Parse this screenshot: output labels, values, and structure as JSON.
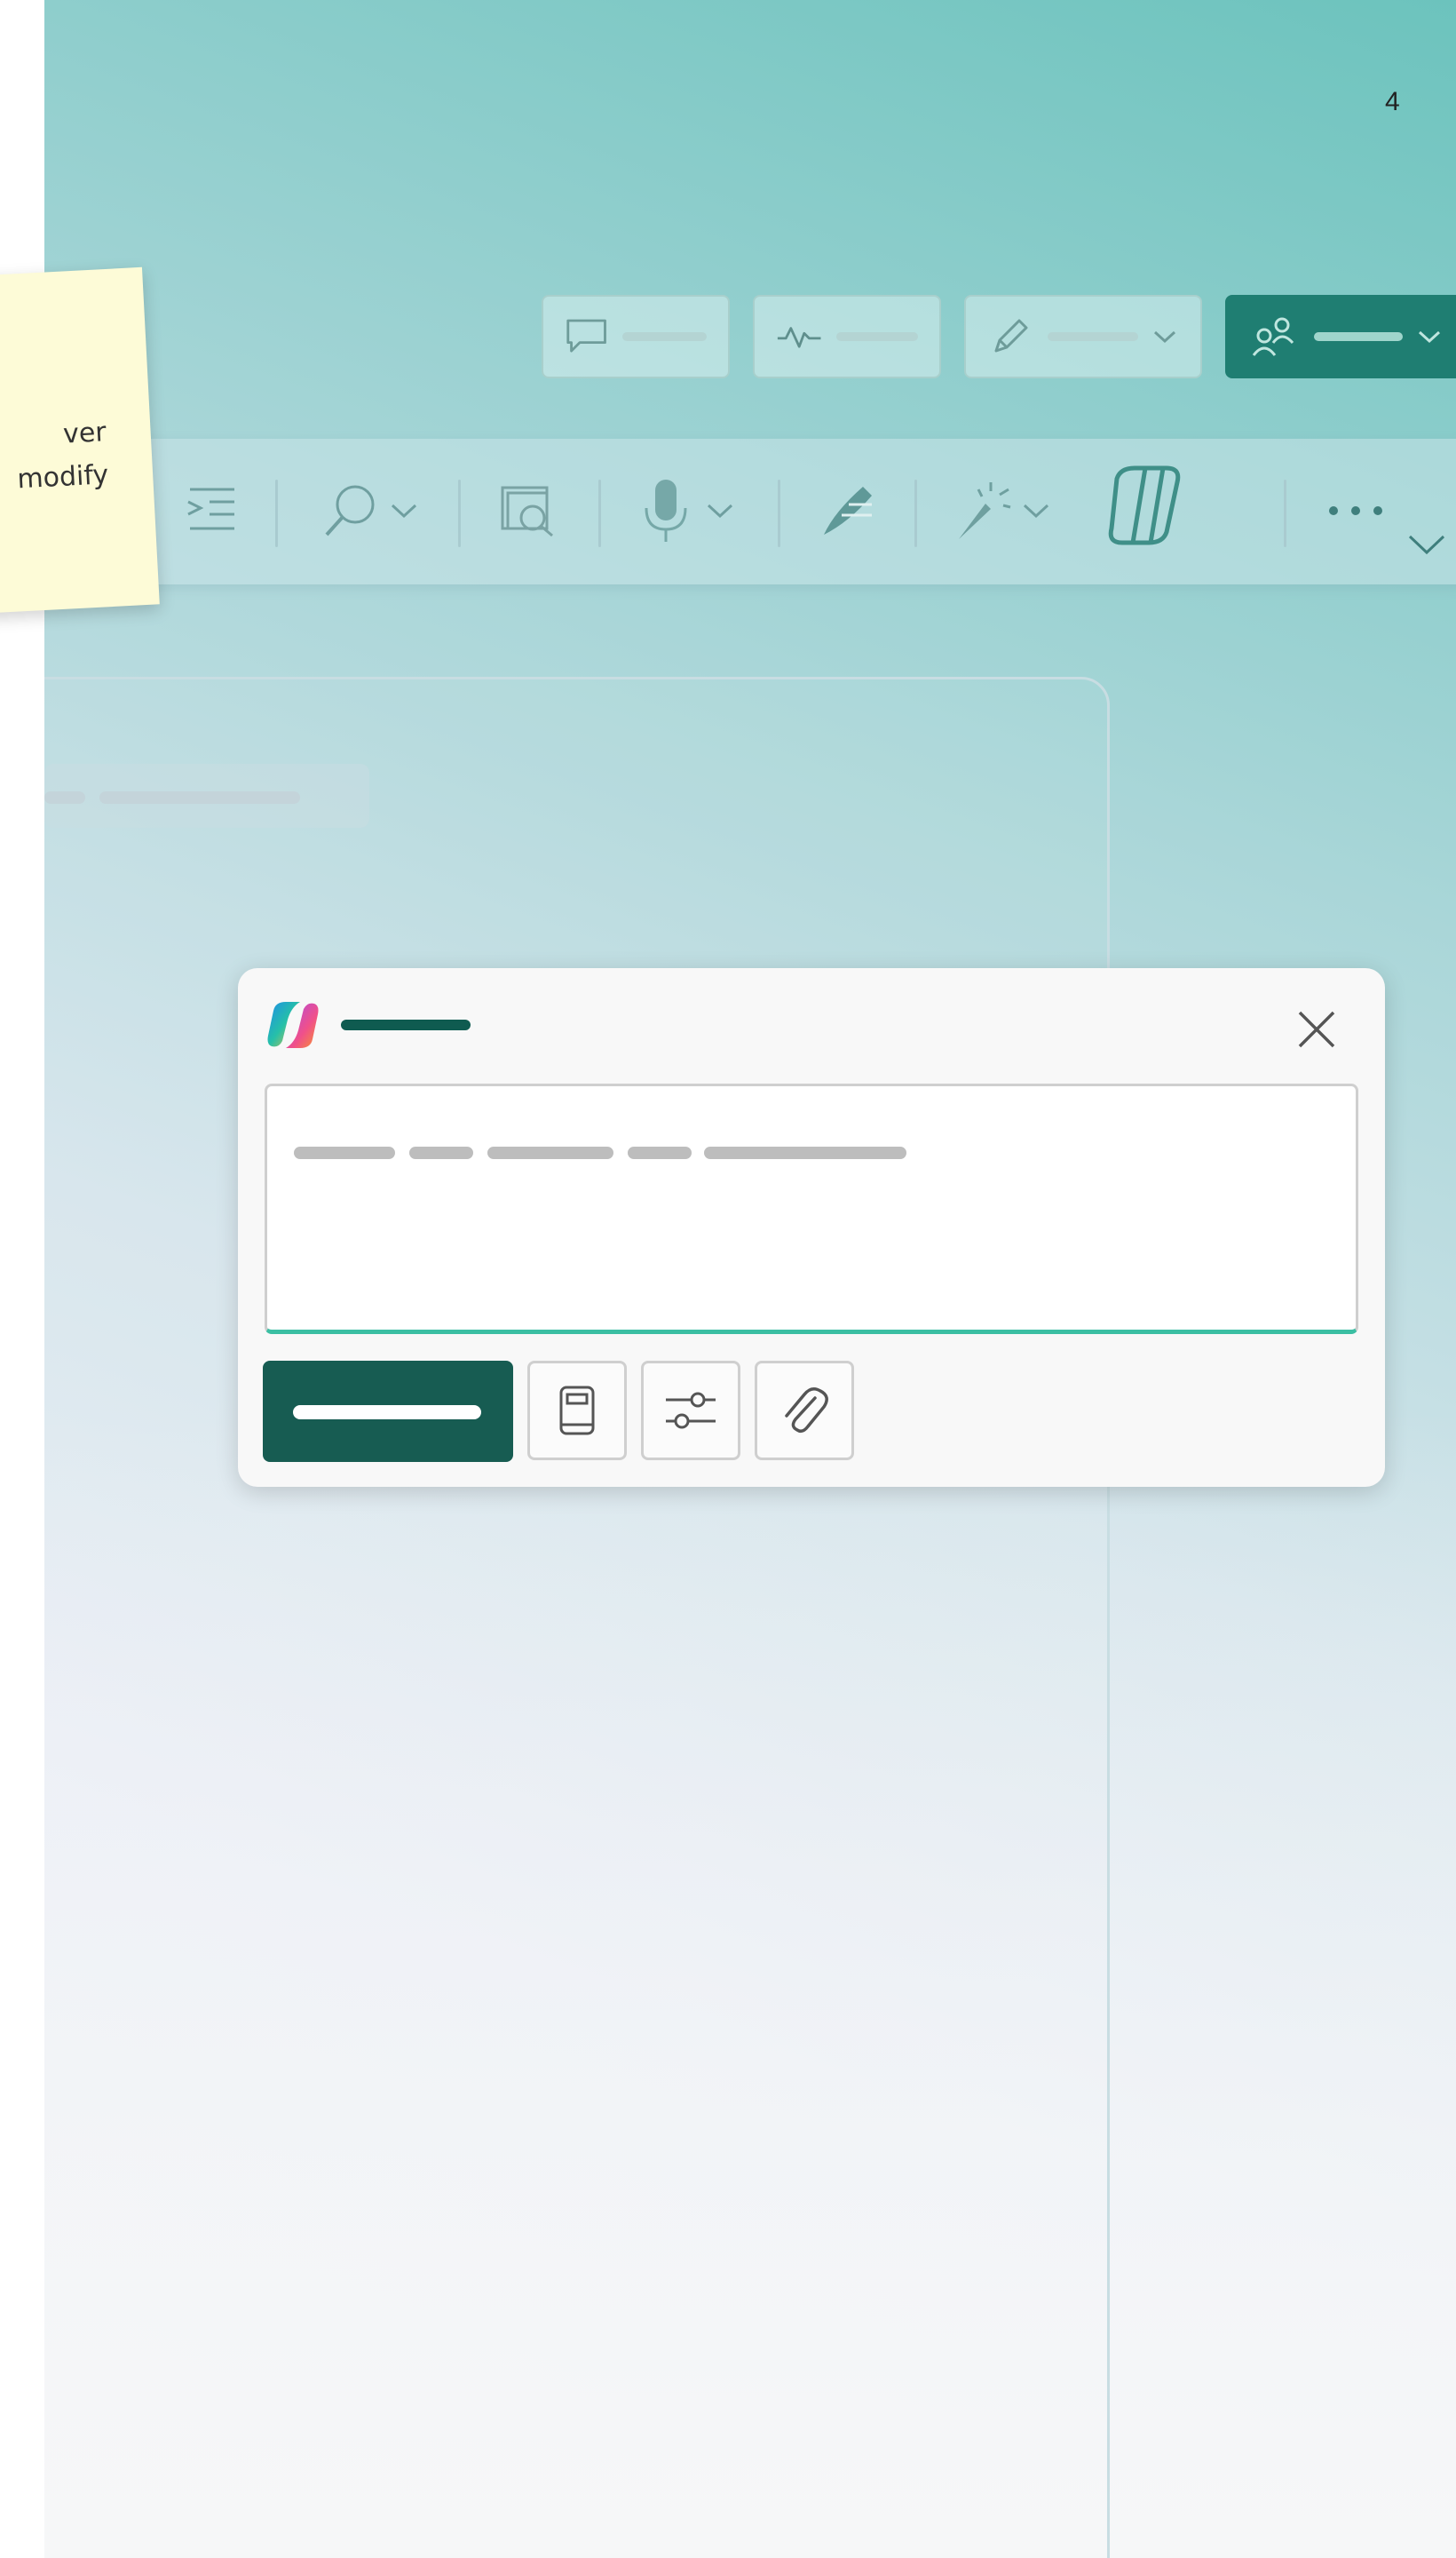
{
  "page": {
    "number": "4"
  },
  "sticky_note": {
    "lines": [
      "ver",
      "modify"
    ]
  },
  "command_bar": {
    "buttons": [
      {
        "icon": "comment-icon"
      },
      {
        "icon": "activity-icon"
      },
      {
        "icon": "pen-icon",
        "has_dropdown": true
      },
      {
        "icon": "share-people-icon",
        "has_dropdown": true,
        "primary": true
      }
    ]
  },
  "ribbon": {
    "items": [
      {
        "icon": "indent-icon"
      },
      {
        "icon": "search-icon",
        "has_dropdown": true
      },
      {
        "icon": "immersive-reader-icon"
      },
      {
        "icon": "microphone-icon",
        "has_dropdown": true
      },
      {
        "icon": "ink-pen-icon"
      },
      {
        "icon": "designer-wand-icon",
        "has_dropdown": true
      },
      {
        "icon": "copilot-icon"
      },
      {
        "icon": "more-icon"
      },
      {
        "icon": "expand-chevron-icon"
      }
    ]
  },
  "copilot_dialog": {
    "logo": "copilot-logo",
    "close_icon": "close-icon",
    "tool_buttons": [
      {
        "icon": "notebook-icon"
      },
      {
        "icon": "settings-sliders-icon"
      },
      {
        "icon": "attachment-icon"
      }
    ]
  },
  "colors": {
    "brand_dark": "#175c52",
    "accent": "#3bbfa3",
    "command_primary": "#1f7e72"
  }
}
